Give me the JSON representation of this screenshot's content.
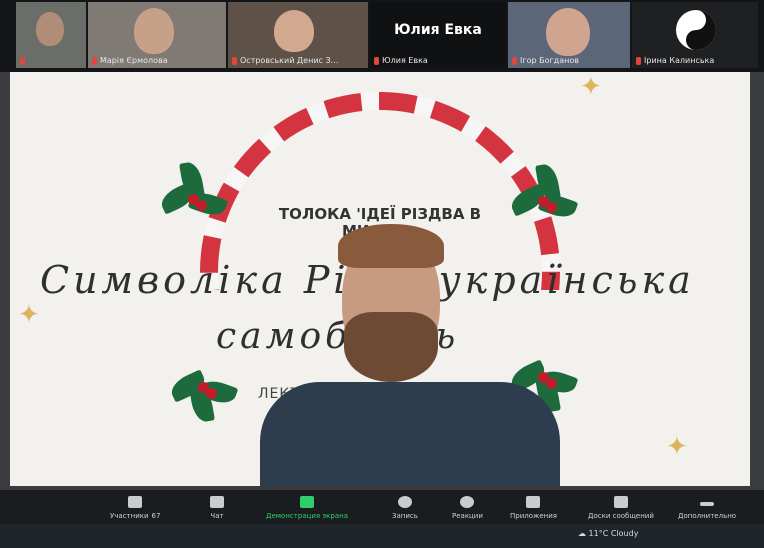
{
  "participants": [
    {
      "name": ""
    },
    {
      "name": "Марія Єрмолова"
    },
    {
      "name": "Островський Денис З..."
    },
    {
      "name": "Юлия Евка"
    },
    {
      "name": "Ігор Богданов"
    },
    {
      "name": "Ірина Калинська"
    }
  ],
  "featured_name": "Юлия Евка",
  "slide": {
    "heading": "ТОЛОКА 'ІДЕЇ РІЗДВА В МИСТЕ...",
    "line1": "Символіка Різ... українська",
    "line2": "самоб...ть",
    "lecturer": "ЛЕКТО..."
  },
  "toolbar": {
    "participants_label": "Участники",
    "participants_count": "67",
    "chat_label": "Чат",
    "share_label": "Демонстрация экрана",
    "record_label": "Запись",
    "reactions_label": "Реакции",
    "apps_label": "Приложения",
    "whiteboard_label": "Доски сообщений",
    "more_label": "Дополнительно"
  },
  "taskbar": {
    "weather": "11°C  Cloudy"
  },
  "colors": {
    "share_active": "#2ccf6b",
    "mic_muted": "#e0483e",
    "candy_red": "#d0202c"
  }
}
